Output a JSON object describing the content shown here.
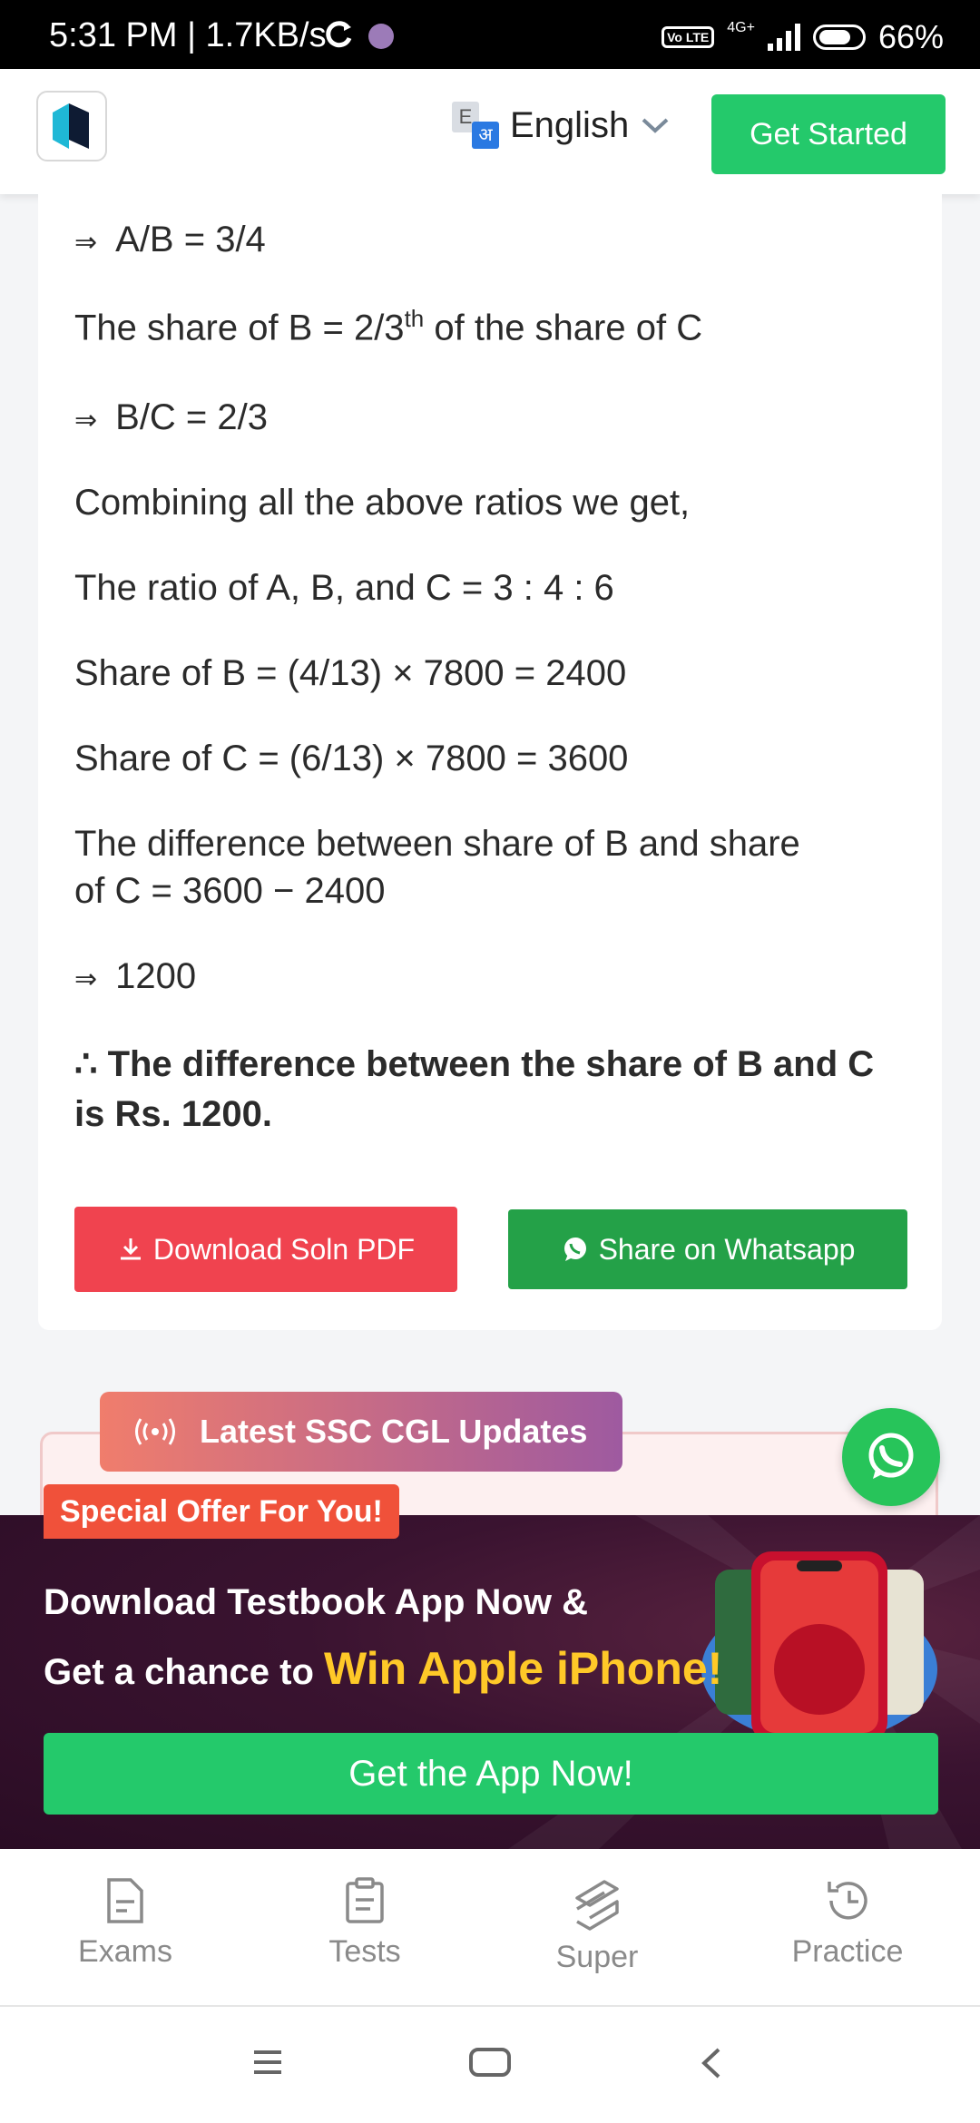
{
  "status_bar": {
    "time": "5:31 PM | 1.7KB/s",
    "network": "4G+",
    "vo_label": "Vo LTE",
    "battery": "66%"
  },
  "header": {
    "language": "English",
    "get_started": "Get Started"
  },
  "solution": {
    "l1": "A/B = 3/4",
    "l2_pre": "The share of B = 2/3",
    "l2_sup": "th",
    "l2_post": " of the share of C",
    "l3": "B/C = 2/3",
    "l4": "Combining all the above ratios we get,",
    "l5": "The ratio of A, B, and C = 3 : 4 : 6",
    "l6": "Share of B = (4/13) × 7800 = 2400",
    "l7": "Share of C = (6/13) × 7800 = 3600",
    "l8a": "The difference between share of B and share",
    "l8b": "of C = 3600 − 2400",
    "l9": "1200",
    "conclusion_a": "∴ The difference between the share of B and C",
    "conclusion_b": "is Rs. 1200."
  },
  "actions": {
    "download": "Download Soln PDF",
    "share": "Share on Whatsapp"
  },
  "updates": {
    "label": "Latest SSC CGL Updates"
  },
  "promo": {
    "offer": "Special Offer For You!",
    "line1": "Download Testbook App Now &",
    "line2_pre": "Get a chance to ",
    "line2_highlight": "Win Apple iPhone!",
    "cta": "Get the App Now!"
  },
  "bottom_nav": {
    "exams": "Exams",
    "tests": "Tests",
    "super": "Super",
    "practice": "Practice"
  },
  "colors": {
    "green": "#24c96b",
    "red": "#f0434f",
    "whatsapp": "#24a148",
    "offer": "#f0513a",
    "highlight": "#ffc928"
  }
}
